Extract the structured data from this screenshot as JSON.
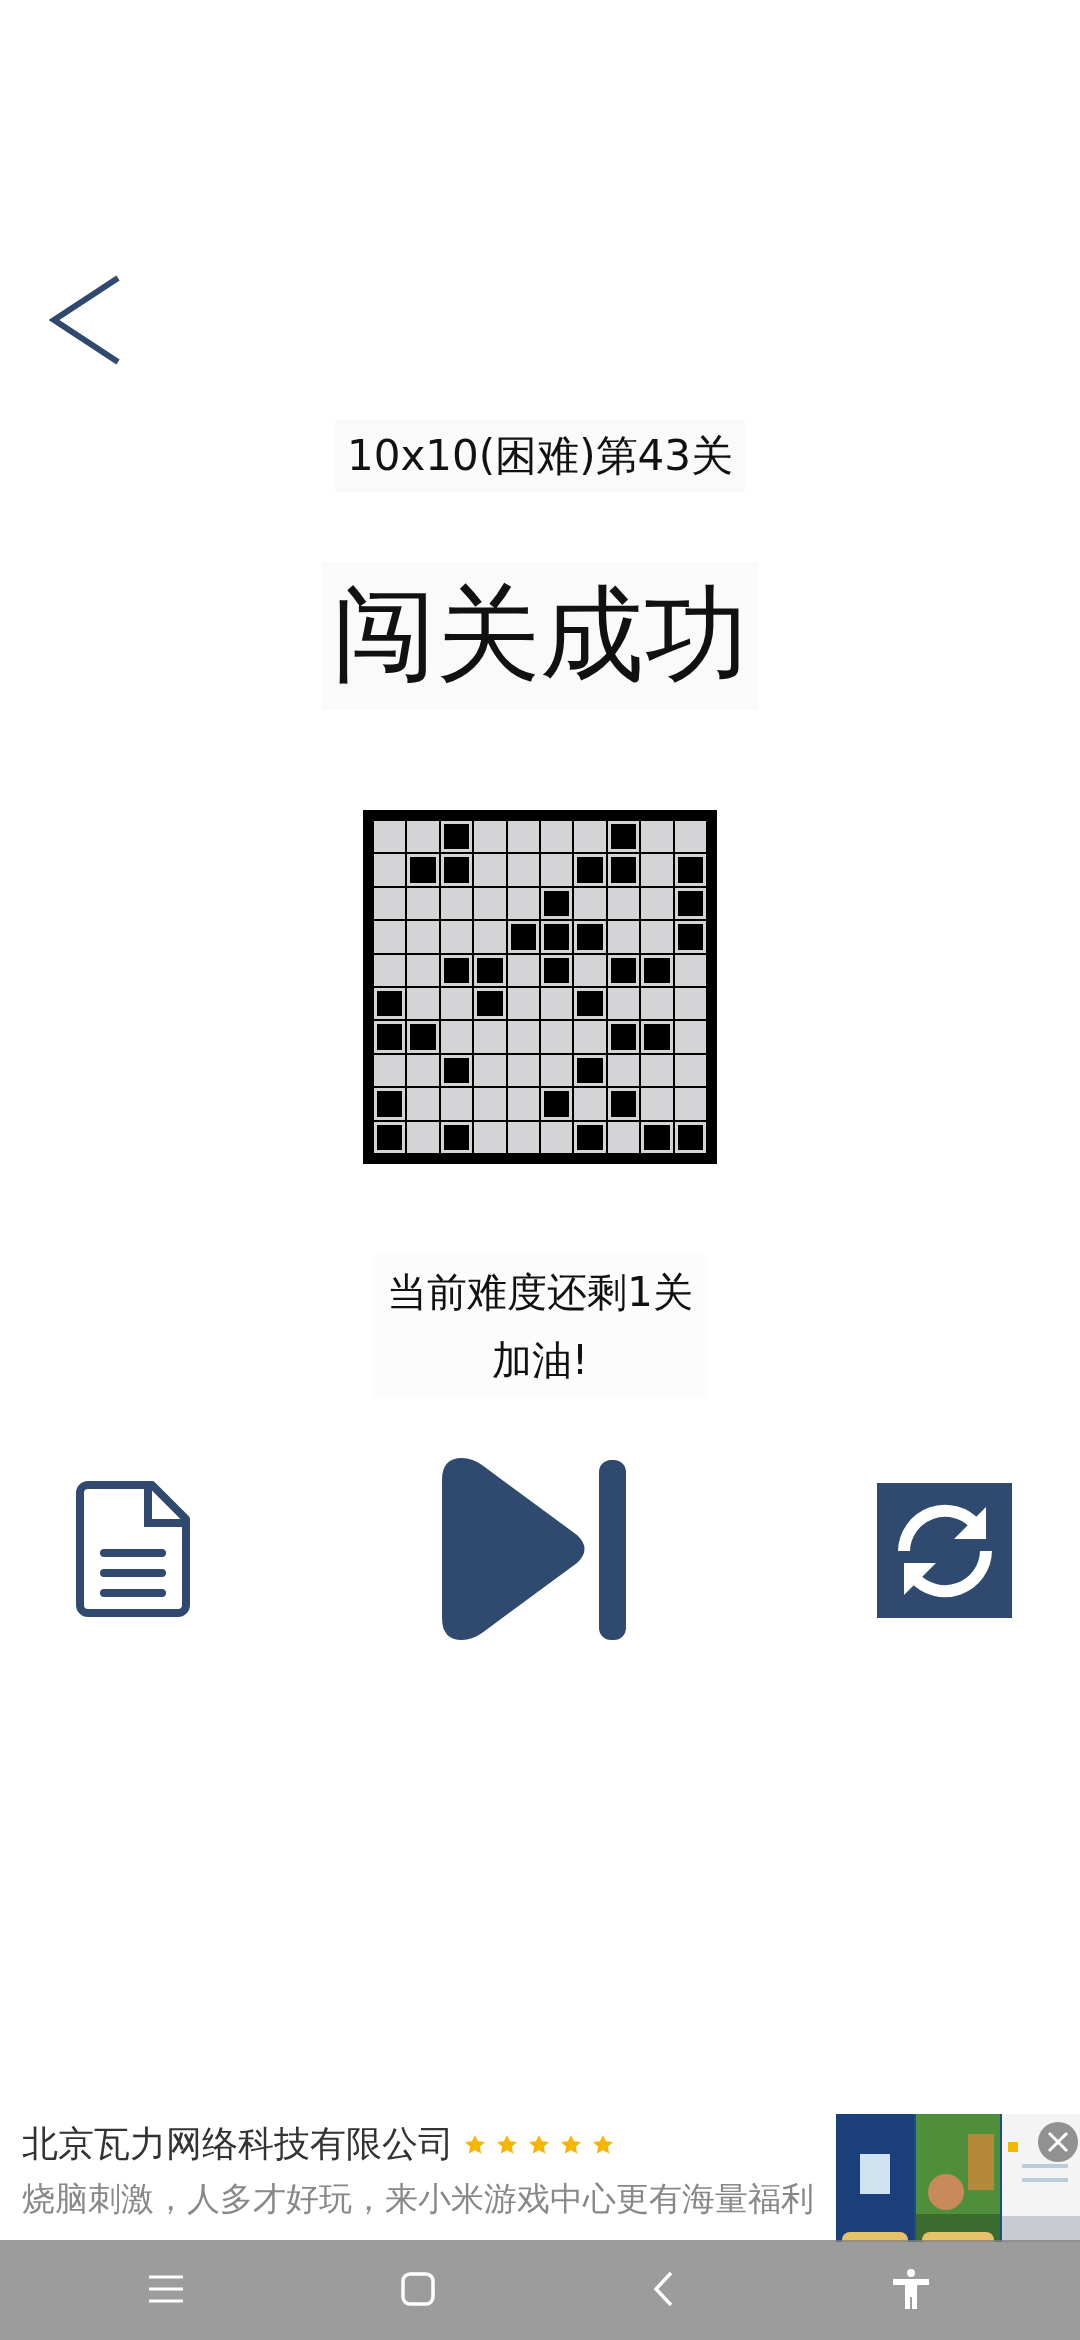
{
  "header": {
    "level_title": "10x10(困难)第43关"
  },
  "result": {
    "title": "闯关成功"
  },
  "grid": {
    "rows": [
      {
        "cells": [
          false,
          false,
          true,
          false,
          false,
          false,
          false,
          true,
          false,
          false
        ]
      },
      {
        "cells": [
          false,
          true,
          true,
          false,
          false,
          false,
          true,
          true,
          false,
          true
        ]
      },
      {
        "cells": [
          false,
          false,
          false,
          false,
          false,
          true,
          false,
          false,
          false,
          true
        ]
      },
      {
        "cells": [
          false,
          false,
          false,
          false,
          true,
          true,
          true,
          false,
          false,
          true
        ]
      },
      {
        "cells": [
          false,
          false,
          true,
          true,
          false,
          true,
          false,
          true,
          true,
          false
        ]
      },
      {
        "cells": [
          true,
          false,
          false,
          true,
          false,
          false,
          true,
          false,
          false,
          false
        ]
      },
      {
        "cells": [
          true,
          true,
          false,
          false,
          false,
          false,
          false,
          true,
          true,
          false
        ]
      },
      {
        "cells": [
          false,
          false,
          true,
          false,
          false,
          false,
          true,
          false,
          false,
          false
        ]
      },
      {
        "cells": [
          true,
          false,
          false,
          false,
          false,
          true,
          false,
          true,
          false,
          false
        ]
      },
      {
        "cells": [
          true,
          false,
          true,
          false,
          false,
          false,
          true,
          false,
          true,
          true
        ]
      }
    ]
  },
  "message": {
    "lines": [
      "当前难度还剩1关",
      "加油!"
    ]
  },
  "ad": {
    "company": "北京瓦力网络科技有限公司",
    "stars": 5,
    "description": "烧脑刺激，人多才好玩，来小米游戏中心更有海量福利"
  }
}
